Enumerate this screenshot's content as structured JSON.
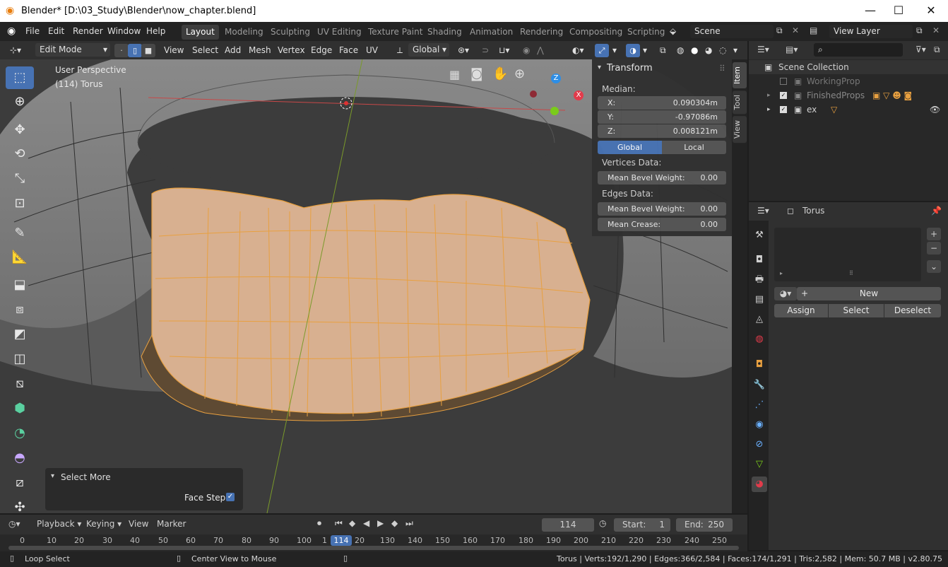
{
  "window": {
    "title": "Blender* [D:\\03_Study\\Blender\\now_chapter.blend]",
    "minimize": "—",
    "maximize": "☐",
    "close": "✕"
  },
  "menu": {
    "items": [
      "File",
      "Edit",
      "Render",
      "Window",
      "Help"
    ]
  },
  "workspaces": [
    "Layout",
    "Modeling",
    "Sculpting",
    "UV Editing",
    "Texture Paint",
    "Shading",
    "Animation",
    "Rendering",
    "Compositing",
    "Scripting"
  ],
  "scene": {
    "name": "Scene",
    "view_layer": "View Layer"
  },
  "viewport_header": {
    "mode": "Edit Mode",
    "menus": [
      "View",
      "Select",
      "Add",
      "Mesh",
      "Vertex",
      "Edge",
      "Face",
      "UV"
    ],
    "orientation": "Global"
  },
  "viewport": {
    "perspective": "User Perspective",
    "object_label": "(114) Torus",
    "gizmo_z": "Z",
    "gizmo_x": "X"
  },
  "npanel": {
    "title": "Transform",
    "median_label": "Median:",
    "x_label": "X:",
    "x": "0.090304m",
    "y_label": "Y:",
    "y": "-0.97086m",
    "z_label": "Z:",
    "z": "0.008121m",
    "global": "Global",
    "local": "Local",
    "vertices_data": "Vertices Data:",
    "v_mean_bevel_label": "Mean Bevel Weight:",
    "v_mean_bevel": "0.00",
    "edges_data": "Edges Data:",
    "e_mean_bevel_label": "Mean Bevel Weight:",
    "e_mean_bevel": "0.00",
    "mean_crease_label": "Mean Crease:",
    "mean_crease": "0.00",
    "tabs": [
      "Item",
      "Tool",
      "View"
    ]
  },
  "outliner": {
    "collection": "Scene Collection",
    "items": [
      "WorkingProp",
      "FinishedProps",
      "ex"
    ]
  },
  "properties": {
    "object": "Torus",
    "new": "New",
    "assign": "Assign",
    "select": "Select",
    "deselect": "Deselect"
  },
  "operator_panel": {
    "title": "Select More",
    "face_step": "Face Step"
  },
  "timeline": {
    "menus": [
      "Playback",
      "Keying",
      "View",
      "Marker"
    ],
    "current_frame": "114",
    "start_label": "Start:",
    "start": "1",
    "end_label": "End:",
    "end": "250",
    "ruler": [
      "0",
      "10",
      "20",
      "30",
      "40",
      "50",
      "60",
      "70",
      "80",
      "90",
      "100",
      "1",
      "114",
      "20",
      "130",
      "140",
      "150",
      "160",
      "170",
      "180",
      "190",
      "200",
      "210",
      "220",
      "230",
      "240",
      "250"
    ]
  },
  "status": {
    "left1": "Loop Select",
    "left2": "Center View to Mouse",
    "stats": "Torus | Verts:192/1,290 | Edges:366/2,584 | Faces:174/1,291 | Tris:2,582 | Mem: 50.7 MB | v2.80.75"
  },
  "colors": {
    "accent": "#4772b3",
    "selection": "#e8a040",
    "face_fill": "#d8b090",
    "bg": "#3c3c3c"
  }
}
